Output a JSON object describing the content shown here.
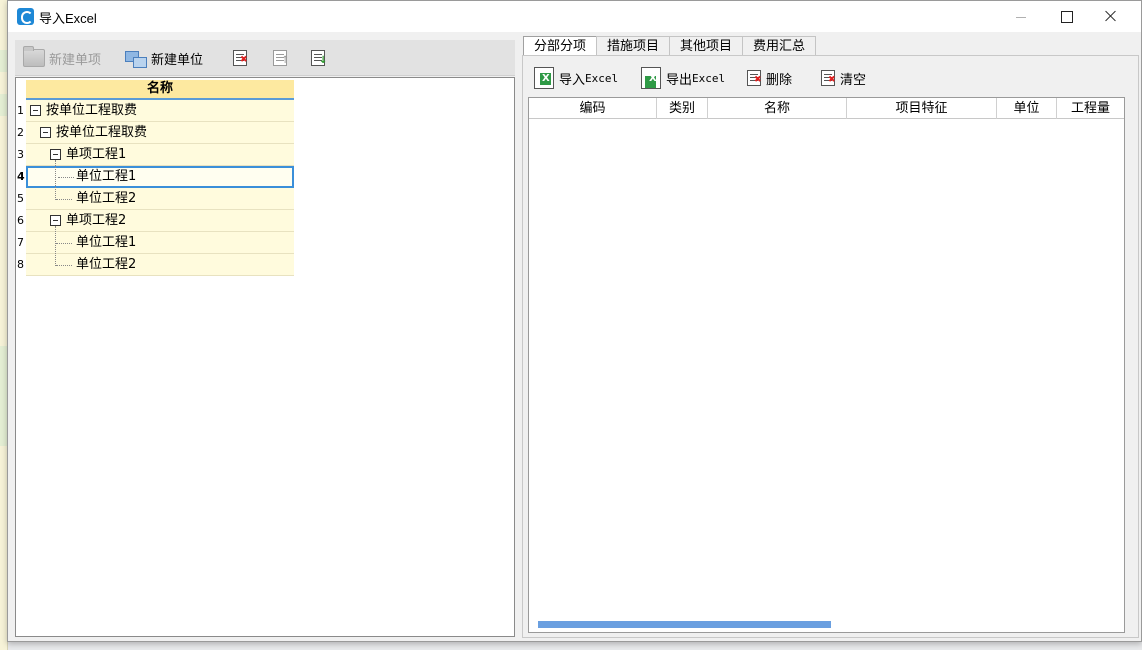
{
  "window": {
    "title": "导入Excel"
  },
  "left_toolbar": {
    "new_item_label": "新建单项",
    "new_unit_label": "新建单位"
  },
  "tree": {
    "column_header": "名称",
    "rows": [
      {
        "num": "1",
        "label": "按单位工程取费"
      },
      {
        "num": "2",
        "label": "按单位工程取费"
      },
      {
        "num": "3",
        "label": "单项工程1"
      },
      {
        "num": "4",
        "label": "单位工程1"
      },
      {
        "num": "5",
        "label": "单位工程2"
      },
      {
        "num": "6",
        "label": "单项工程2"
      },
      {
        "num": "7",
        "label": "单位工程1"
      },
      {
        "num": "8",
        "label": "单位工程2"
      }
    ]
  },
  "tabs": [
    {
      "label": "分部分项"
    },
    {
      "label": "措施项目"
    },
    {
      "label": "其他项目"
    },
    {
      "label": "费用汇总"
    }
  ],
  "right_toolbar": {
    "import_label": "导入",
    "import_suffix": "Excel",
    "export_label": "导出",
    "export_suffix": "Excel",
    "delete_label": "删除",
    "clear_label": "清空"
  },
  "grid_columns": [
    {
      "label": "编码"
    },
    {
      "label": "类别"
    },
    {
      "label": "名称"
    },
    {
      "label": "项目特征"
    },
    {
      "label": "单位"
    },
    {
      "label": "工程量"
    }
  ]
}
